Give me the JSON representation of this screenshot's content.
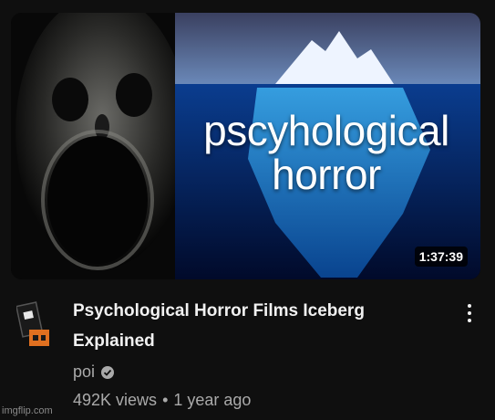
{
  "thumbnail": {
    "overlay_text_line1": "pscyhological",
    "overlay_text_line2": "horror",
    "duration": "1:37:39"
  },
  "video": {
    "title": "Psychological Horror Films Iceberg Explained",
    "channel_name": "poi",
    "verified_icon": "verified-check-icon",
    "views": "492K views",
    "separator": "•",
    "age": "1 year ago"
  },
  "menu": {
    "icon": "more-vert-icon"
  },
  "watermark": "imgflip.com",
  "colors": {
    "background": "#0f0f0f",
    "title_text": "#f1f1f1",
    "meta_text": "#aaaaaa",
    "iceberg_water": "#0a3d8f",
    "avatar_orange": "#e07020"
  }
}
